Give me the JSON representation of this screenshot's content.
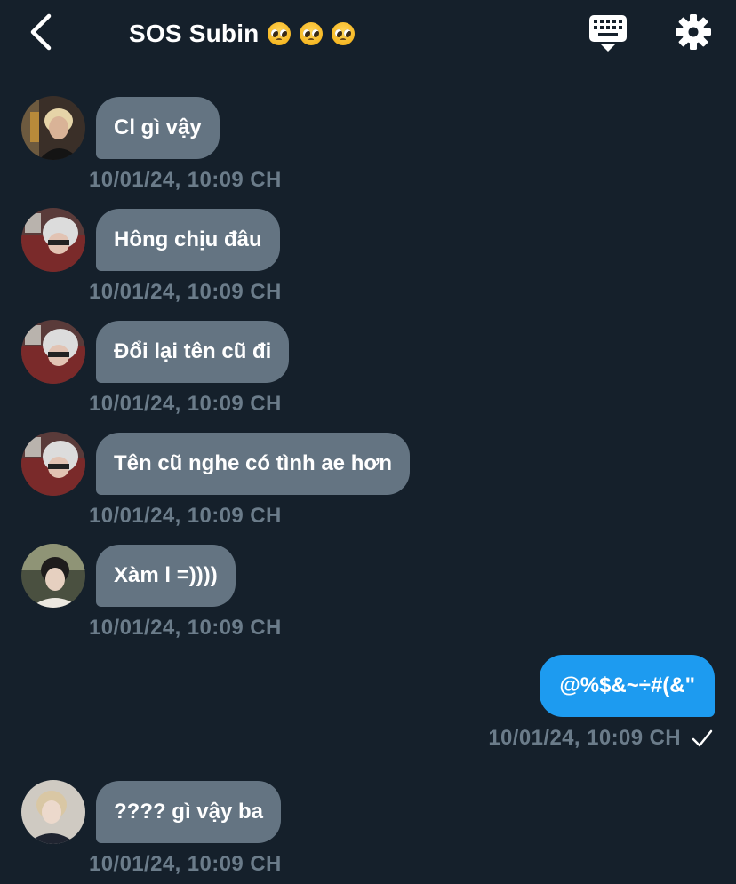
{
  "header": {
    "title": "SOS Subin",
    "title_emojis": [
      "pleading-face",
      "pleading-face",
      "pleading-face"
    ],
    "back_icon": "chevron-left-icon",
    "keyboard_icon": "keyboard-icon",
    "settings_icon": "gear-icon"
  },
  "colors": {
    "background": "#15202b",
    "incoming_bubble": "#647482",
    "outgoing_bubble": "#1d9bf0",
    "timestamp": "#6b7c8a"
  },
  "messages": [
    {
      "direction": "incoming",
      "text": "Cl gì vậy",
      "timestamp": "10/01/24, 10:09 CH",
      "avatar": "avatar-blonde"
    },
    {
      "direction": "incoming",
      "text": "Hông chịu đâu",
      "timestamp": "10/01/24, 10:09 CH",
      "avatar": "avatar-silver"
    },
    {
      "direction": "incoming",
      "text": "Đổi lại tên cũ đi",
      "timestamp": "10/01/24, 10:09 CH",
      "avatar": "avatar-silver"
    },
    {
      "direction": "incoming",
      "text": "Tên cũ nghe có tình ae hơn",
      "timestamp": "10/01/24, 10:09 CH",
      "avatar": "avatar-silver"
    },
    {
      "direction": "incoming",
      "text": "Xàm l =))))",
      "timestamp": "10/01/24, 10:09 CH",
      "avatar": "avatar-dark"
    },
    {
      "direction": "outgoing",
      "text": "@%$&~÷#(&\"",
      "timestamp": "10/01/24, 10:09 CH",
      "status_icon": "checkmark-icon"
    },
    {
      "direction": "incoming",
      "text": "???? gì vậy ba",
      "timestamp": "10/01/24, 10:09 CH",
      "avatar": "avatar-portrait"
    }
  ]
}
